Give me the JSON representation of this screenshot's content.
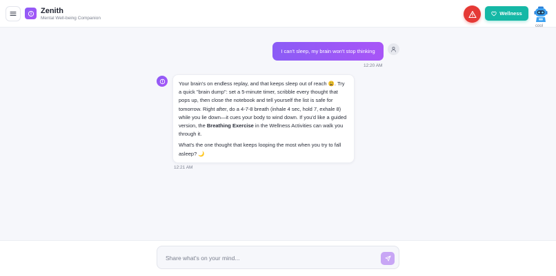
{
  "header": {
    "title": "Zenith",
    "subtitle": "Mental Well-being Companion",
    "wellness_label": "Wellness",
    "profile_name": "cool"
  },
  "chat": {
    "user_message": {
      "text": "I can't sleep, my brain won't stop thinking",
      "time": "12:20 AM"
    },
    "bot_message": {
      "para1_before": "Your brain's on endless replay, and that keeps sleep out of reach 😩. Try a quick \"brain dump\": set a 5-minute timer, scribble every thought that pops up, then close the notebook and tell yourself the list is safe for tomorrow. Right after, do a 4-7-8 breath (inhale 4 sec, hold 7, exhale 8) while you lie down—it cues your body to wind down. If you'd like a guided version, the ",
      "para1_bold": "Breathing Exercise",
      "para1_after": " in the Wellness Activities can walk you through it.",
      "para2": "What's the one thought that keeps looping the most when you try to fall asleep? 🌙",
      "time": "12:21 AM"
    }
  },
  "composer": {
    "placeholder": "Share what's on your mind..."
  },
  "colors": {
    "accent_purple": "#8b5cf6",
    "alert_red": "#e53935",
    "wellness_teal": "#15b8a6"
  },
  "icons": {
    "menu": "menu-icon",
    "logo": "zenith-logo-icon",
    "alert": "warning-triangle-icon",
    "wellness": "heart-icon",
    "user": "user-icon",
    "send": "send-icon"
  }
}
